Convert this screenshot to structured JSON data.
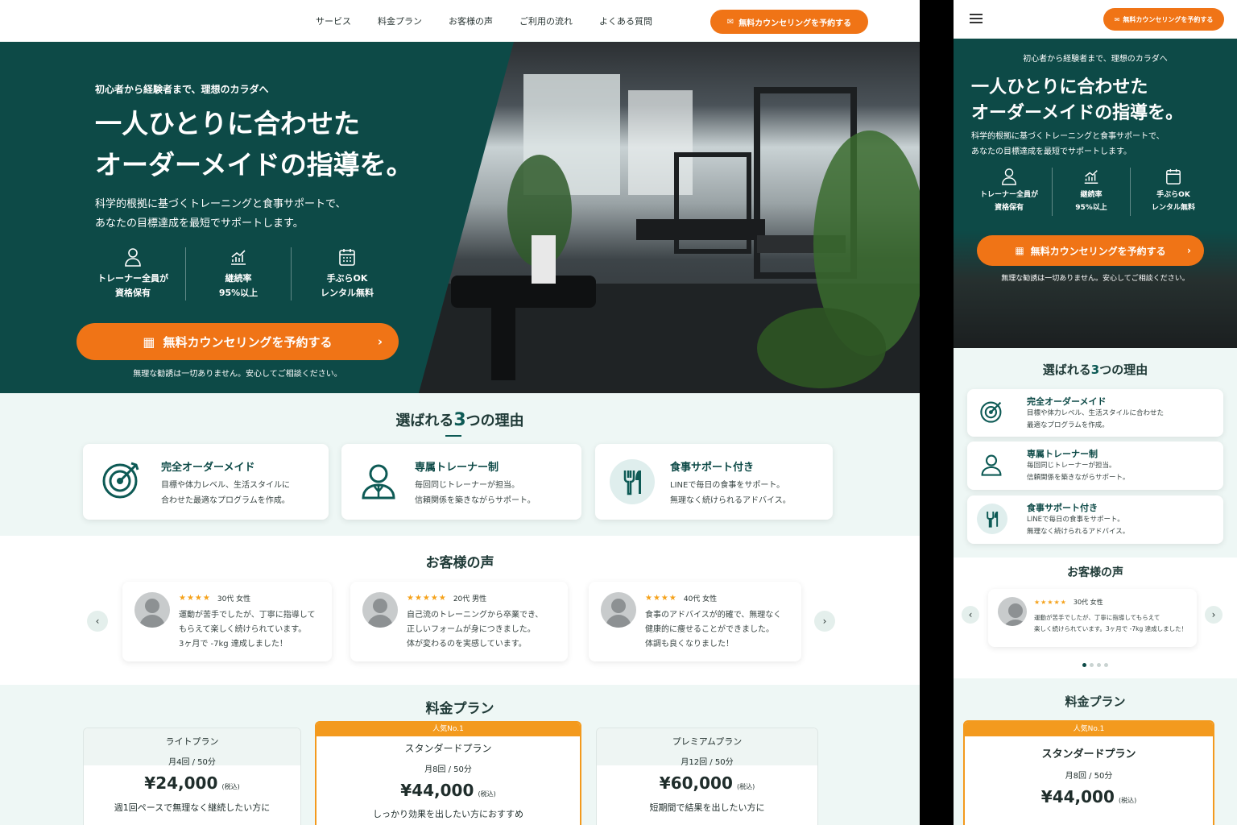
{
  "nav": {
    "links": [
      "サービス",
      "料金プラン",
      "お客様の声",
      "ご利用の流れ",
      "よくある質問"
    ],
    "cta": "無料カウンセリングを予約する"
  },
  "hero": {
    "eyebrow": "初心者から経験者まで、理想のカラダへ",
    "title_line1": "一人ひとりに合わせた",
    "title_line2": "オーダーメイドの指導を。",
    "sub_line1": "科学的根拠に基づくトレーニングと食事サポートで、",
    "sub_line2": "あなたの目標達成を最短でサポートします。",
    "features": [
      {
        "icon": "person-icon",
        "l1": "トレーナー全員が",
        "l2": "資格保有"
      },
      {
        "icon": "growth-chart-icon",
        "l1": "継続率",
        "l2": "95%以上"
      },
      {
        "icon": "calendar-icon",
        "l1": "手ぶらOK",
        "l2": "レンタル無料"
      }
    ],
    "cta": "無料カウンセリングを予約する",
    "note": "無理な勧誘は一切ありません。安心してご相談ください。"
  },
  "reasons": {
    "title_pre": "選ばれる",
    "title_num": "3",
    "title_post": "つの理由",
    "items": [
      {
        "icon": "target-icon",
        "title": "完全オーダーメイド",
        "d1": "目標や体力レベル、生活スタイルに",
        "d2": "合わせた最適なプログラムを作成。",
        "m1": "目標や体力レベル、生活スタイルに合わせた",
        "m2": "最適なプログラムを作成。"
      },
      {
        "icon": "trainer-icon",
        "title": "専属トレーナー制",
        "d1": "毎回同じトレーナーが担当。",
        "d2": "信頼関係を築きながらサポート。",
        "m1": "毎回同じトレーナーが担当。",
        "m2": "信頼関係を築きながらサポート。"
      },
      {
        "icon": "fork-knife-icon",
        "title": "食事サポート付き",
        "d1": "LINEで毎日の食事をサポート。",
        "d2": "無理なく続けられるアドバイス。",
        "m1": "LINEで毎日の食事をサポート。",
        "m2": "無理なく続けられるアドバイス。"
      }
    ]
  },
  "voices": {
    "title": "お客様の声",
    "items": [
      {
        "stars": "★★★★",
        "meta": "30代 女性",
        "l1": "運動が苦手でしたが、丁寧に指導して",
        "l2": "もらえて楽しく続けられています。",
        "l3": "3ヶ月で -7kg 達成しました！"
      },
      {
        "stars": "★★★★★",
        "meta": "20代 男性",
        "l1": "自己流のトレーニングから卒業でき、",
        "l2": "正しいフォームが身につきました。",
        "l3": "体が変わるのを実感しています。"
      },
      {
        "stars": "★★★★",
        "meta": "40代 女性",
        "l1": "食事のアドバイスが的確で、無理なく",
        "l2": "健康的に痩せることができました。",
        "l3": "体調も良くなりました！"
      }
    ],
    "mobile": {
      "stars": "★★★★★",
      "meta": "30代 女性",
      "l1": "運動が苦手でしたが、丁寧に指導してもらえて",
      "l2": "楽しく続けられています。3ヶ月で -7kg 達成しました！"
    }
  },
  "pricing": {
    "title": "料金プラン",
    "popular": "人気No.1",
    "plans": [
      {
        "name": "ライトプラン",
        "freq": "月4回 / 50分",
        "price": "¥24,000",
        "tax": "(税込)",
        "desc": "週1回ペースで無理なく継続したい方に"
      },
      {
        "name": "スタンダードプラン",
        "freq": "月8回 / 50分",
        "price": "¥44,000",
        "tax": "(税込)",
        "desc": "しっかり効果を出したい方におすすめ"
      },
      {
        "name": "プレミアムプラン",
        "freq": "月12回 / 50分",
        "price": "¥60,000",
        "tax": "(税込)",
        "desc": "短期間で結果を出したい方に"
      }
    ]
  },
  "colors": {
    "brand": "#0d4a47",
    "accent": "#f07416",
    "popular": "#f39a1e"
  }
}
